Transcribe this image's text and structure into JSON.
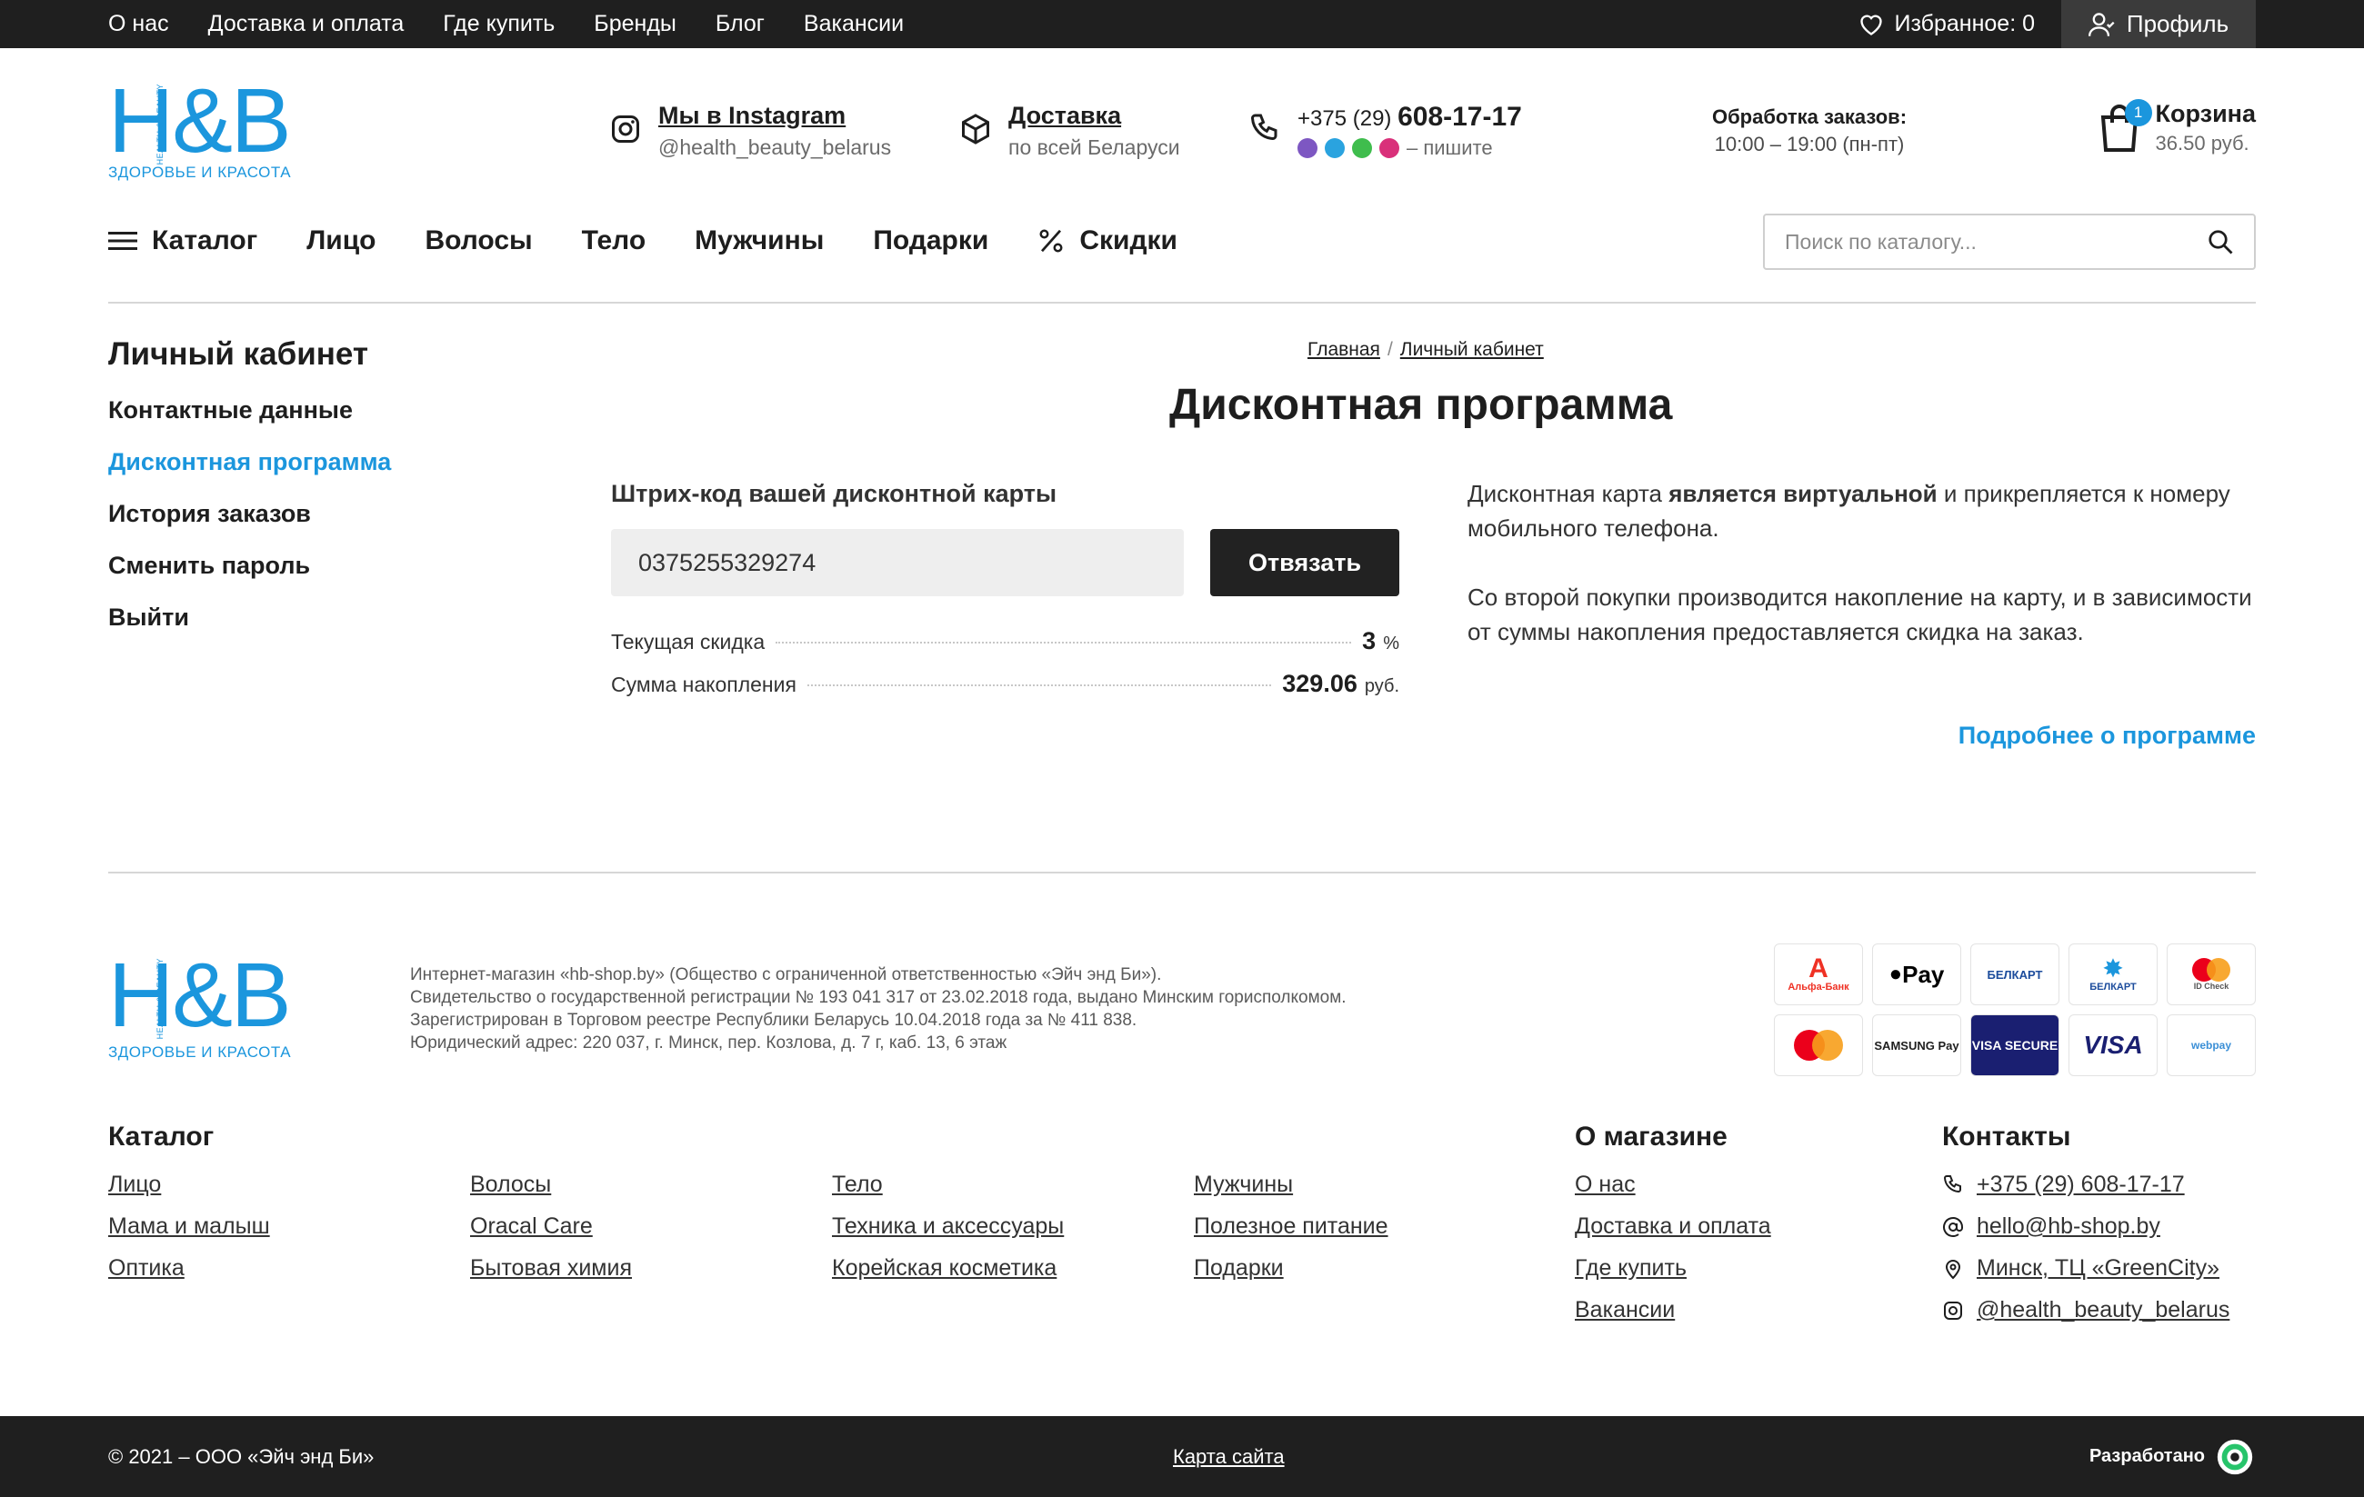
{
  "topbar": {
    "nav": [
      "О нас",
      "Доставка и оплата",
      "Где купить",
      "Бренды",
      "Блог",
      "Вакансии"
    ],
    "favorites": "Избранное: 0",
    "profile": "Профиль"
  },
  "logo": {
    "mark": "H&B",
    "vertical": "HEALTH & BEAUTY",
    "tagline": "ЗДОРОВЬЕ И КРАСОТА"
  },
  "header": {
    "instagram": {
      "title": "Мы в Instagram",
      "handle": "@health_beauty_belarus"
    },
    "delivery": {
      "title": "Доставка",
      "subtitle": "по всей Беларуси"
    },
    "phone": {
      "prefix": "+375 (29)",
      "number": "608-17-17",
      "write": "– пишите"
    },
    "hours": {
      "title": "Обработка заказов:",
      "value": "10:00 – 19:00 (пн-пт)"
    },
    "cart": {
      "title": "Корзина",
      "sum": "36.50 руб.",
      "count": "1"
    }
  },
  "mainnav": {
    "catalog": "Каталог",
    "items": [
      "Лицо",
      "Волосы",
      "Тело",
      "Мужчины",
      "Подарки"
    ],
    "sale": "Скидки"
  },
  "search": {
    "placeholder": "Поиск по каталогу..."
  },
  "sidebar": {
    "title": "Личный кабинет",
    "items": [
      "Контактные данные",
      "Дисконтная программа",
      "История заказов",
      "Сменить пароль",
      "Выйти"
    ]
  },
  "breadcrumbs": [
    "Главная",
    "Личный кабинет"
  ],
  "page_title": "Дисконтная программа",
  "discount": {
    "barcode_label": "Штрих-код вашей дисконтной карты",
    "barcode": "0375255329274",
    "unlink": "Отвязать",
    "current_label": "Текущая скидка",
    "current_value": "3",
    "current_unit": "%",
    "sum_label": "Сумма накопления",
    "sum_value": "329.06",
    "sum_unit": "руб."
  },
  "info": {
    "p1_a": "Дисконтная карта ",
    "p1_b": "является виртуальной",
    "p1_c": " и прикрепляется к номеру мобильного телефона.",
    "p2": "Со второй покупки производится накопление на карту, и в зависимости от суммы накопления предоставляется скидка на заказ.",
    "more": "Подробнее о программе"
  },
  "footer": {
    "legal": [
      "Интернет-магазин «hb-shop.by» (Общество с ограниченной ответственностью «Эйч энд Би»).",
      "Свидетельство о государственной регистрации № 193 041 317 от 23.02.2018 года, выдано Минским горисполкомом.",
      "Зарегистрирован в Торговом реестре Республики Беларусь 10.04.2018 года за № 411 838.",
      "Юридический адрес: 220 037, г. Минск, пер. Козлова, д. 7 г, каб. 13, 6 этаж"
    ],
    "payments": [
      "Альфа-Банк",
      "Pay",
      "БЕЛКАРТ",
      "БЕЛКАРТ",
      "ID Check",
      "",
      "SAMSUNG Pay",
      "VISA SECURE",
      "VISA",
      "webpay"
    ],
    "catalog_title": "Катaлог",
    "catalog_cols": [
      [
        "Лицо",
        "Мама и малыш",
        "Оптика"
      ],
      [
        "Волосы",
        "Oracal Care",
        "Бытовая химия"
      ],
      [
        "Тело",
        "Техника и аксессуары",
        "Корейская косметика"
      ],
      [
        "Мужчины",
        "Полезное питание",
        "Подарки"
      ]
    ],
    "about_title": "О магазине",
    "about": [
      "О нас",
      "Доставка и оплата",
      "Где купить",
      "Вакансии"
    ],
    "contacts_title": "Контакты",
    "contacts": [
      "+375 (29) 608-17-17",
      "hello@hb-shop.by",
      "Минск, ТЦ «GreenCity»",
      "@health_beauty_belarus"
    ],
    "copyright": "© 2021 – ООО «Эйч энд Би»",
    "sitemap": "Карта сайта",
    "developer": "Разработано"
  },
  "colors": {
    "accent": "#1b96dd",
    "dark": "#1f1f1f"
  }
}
